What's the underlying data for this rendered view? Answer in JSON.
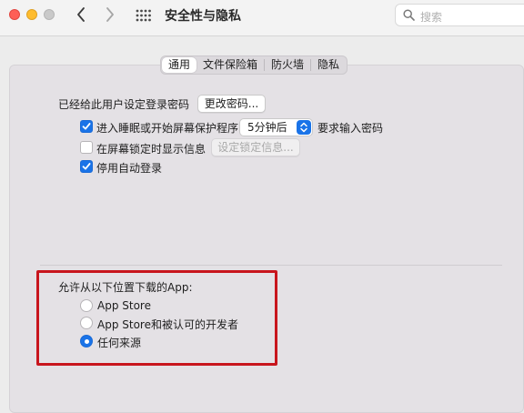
{
  "window": {
    "title": "安全性与隐私",
    "search_placeholder": "搜索"
  },
  "tabs": [
    {
      "label": "通用",
      "active": true
    },
    {
      "label": "文件保险箱",
      "active": false
    },
    {
      "label": "防火墙",
      "active": false
    },
    {
      "label": "隐私",
      "active": false
    }
  ],
  "general": {
    "password_set_label": "已经给此用户设定登录密码",
    "change_password_button": "更改密码...",
    "require_password": {
      "checked": true,
      "label_before": "进入睡眠或开始屏幕保护程序",
      "delay_value": "5分钟后",
      "label_after": "要求输入密码"
    },
    "show_message": {
      "checked": false,
      "label": "在屏幕锁定时显示信息",
      "button": "设定锁定信息..."
    },
    "disable_auto_login": {
      "checked": true,
      "label": "停用自动登录"
    }
  },
  "downloads": {
    "heading": "允许从以下位置下载的App:",
    "options": [
      {
        "label": "App Store",
        "selected": false
      },
      {
        "label": "App Store和被认可的开发者",
        "selected": false
      },
      {
        "label": "任何来源",
        "selected": true
      }
    ]
  },
  "colors": {
    "accent": "#1a73e8",
    "highlight": "#c8151d"
  }
}
